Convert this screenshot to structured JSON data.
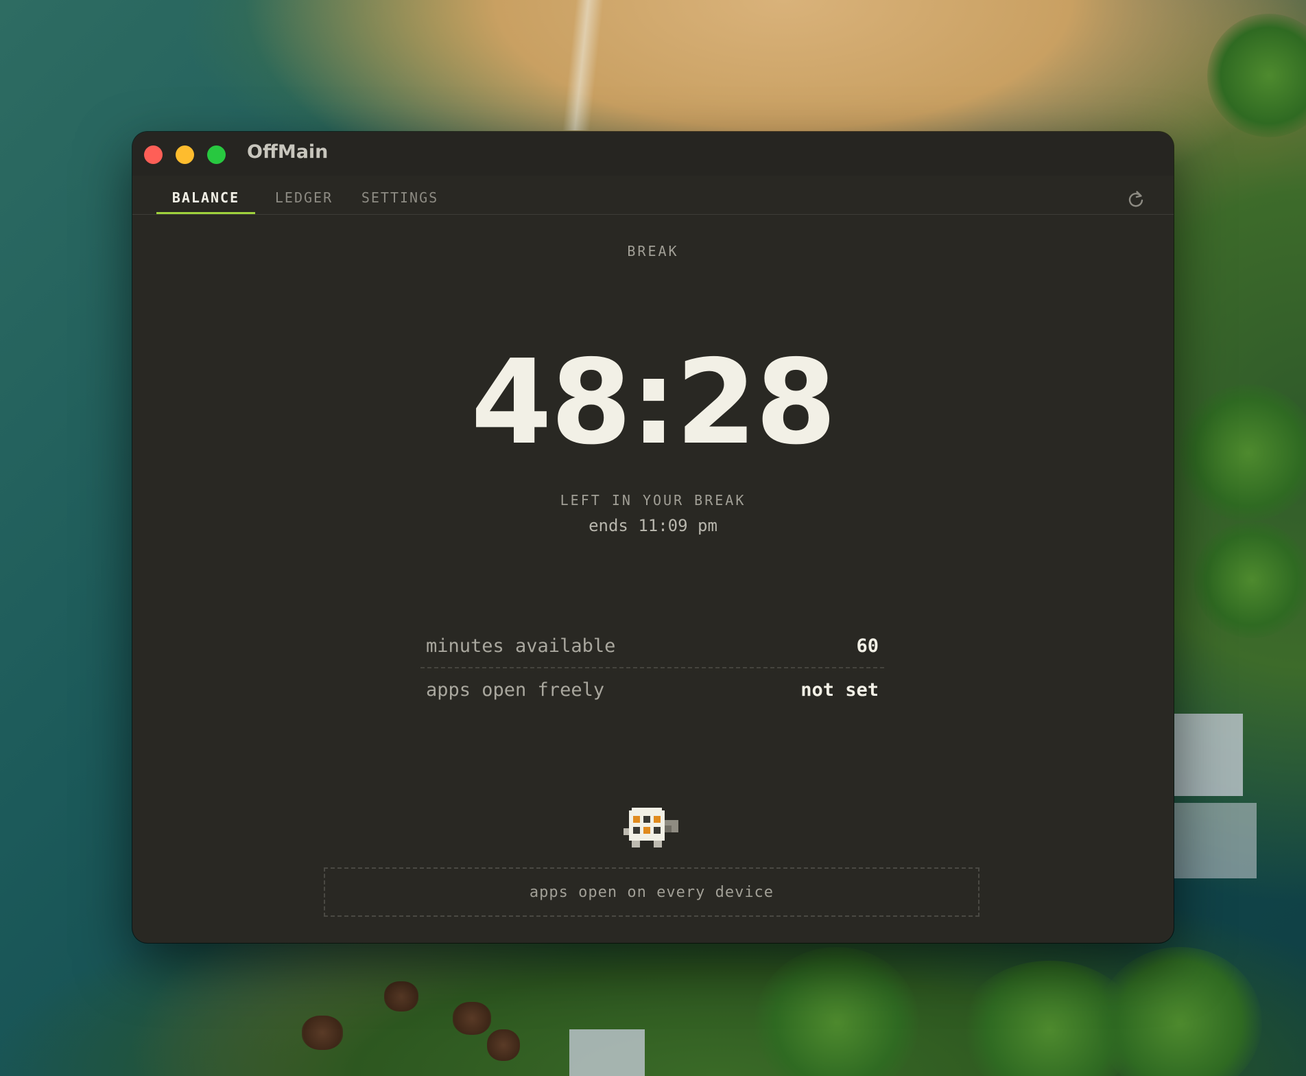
{
  "window": {
    "title": "OffMain"
  },
  "tabs": [
    {
      "label": "BALANCE",
      "active": true
    },
    {
      "label": "LEDGER",
      "active": false
    },
    {
      "label": "SETTINGS",
      "active": false
    }
  ],
  "toolbar": {
    "refresh_icon": "refresh-icon"
  },
  "balance": {
    "mode_label": "BREAK",
    "timer": "48:28",
    "caption": "LEFT IN YOUR BREAK",
    "ends": "ends 11:09 pm",
    "stats": [
      {
        "label": "minutes available",
        "value": "60"
      },
      {
        "label": "apps open freely",
        "value": "not set"
      }
    ],
    "mascot_icon": "pixel-turtle-icon",
    "banner": "apps open on every device"
  },
  "colors": {
    "accent": "#9fd23c",
    "window_bg": "#292823",
    "text_primary": "#f2f0e6",
    "text_muted": "#a19f96",
    "traffic_close": "#fe5f57",
    "traffic_min": "#febc2e",
    "traffic_max": "#28c840"
  }
}
